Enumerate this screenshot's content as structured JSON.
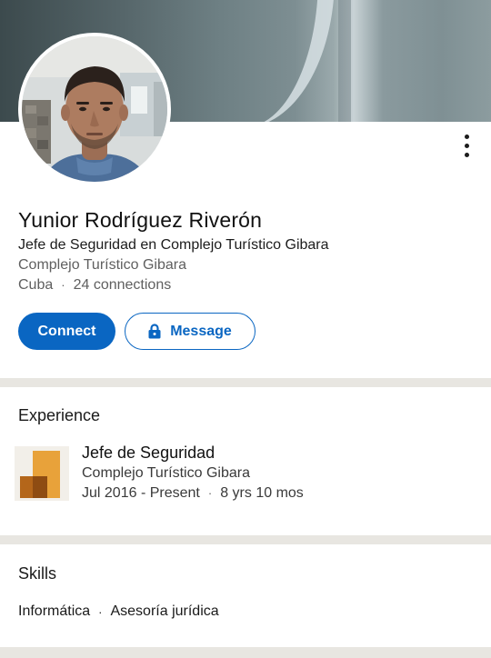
{
  "profile": {
    "name": "Yunior Rodríguez Riverón",
    "headline": "Jefe de Seguridad en Complejo Turístico Gibara",
    "current_company": "Complejo Turístico Gibara",
    "location": "Cuba",
    "connections": "24 connections",
    "avatar_icon": "profile-photo",
    "more_icon": "more-vertical-icon"
  },
  "actions": {
    "connect_label": "Connect",
    "message_label": "Message",
    "lock_icon": "lock-icon"
  },
  "experience": {
    "section_title": "Experience",
    "items": [
      {
        "title": "Jefe de Seguridad",
        "company": "Complejo Turístico Gibara",
        "start": "Jul 2016 - Present",
        "duration": "8 yrs 10 mos",
        "logo_icon": "company-logo-icon"
      }
    ]
  },
  "skills": {
    "section_title": "Skills",
    "items": [
      "Informática",
      "Asesoría jurídica"
    ]
  },
  "colors": {
    "accent": "#0a66c2",
    "divider": "#e8e6e1",
    "logo_orange": "#e8a23a",
    "logo_brown": "#b4661a"
  }
}
